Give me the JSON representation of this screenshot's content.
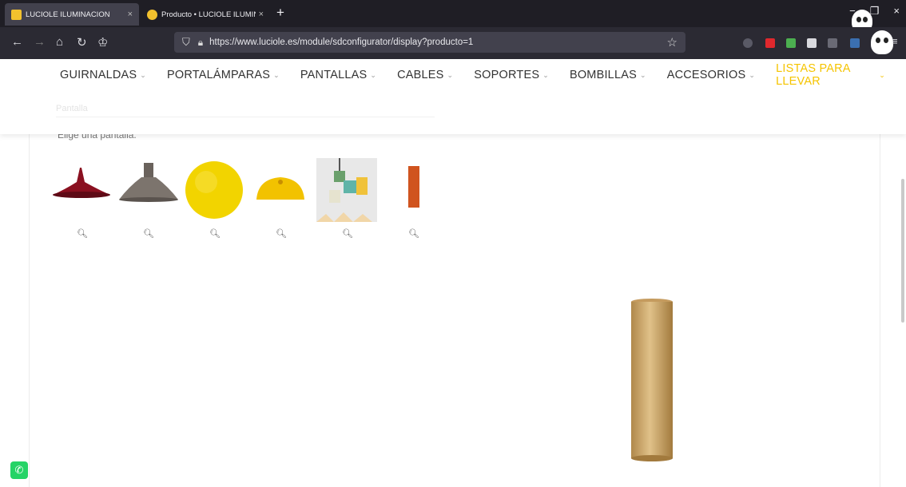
{
  "browser": {
    "tabs": [
      {
        "title": "LUCIOLE ILUMINACION",
        "close": "×"
      },
      {
        "title": "Producto • LUCIOLE ILUMINACI",
        "close": "×"
      }
    ],
    "new_tab": "+",
    "url": "https://www.luciole.es/module/sdconfigurator/display?producto=1",
    "window_controls": {
      "minimize": "−",
      "close": "×"
    }
  },
  "menu": {
    "items": [
      {
        "label": "GUIRNALDAS"
      },
      {
        "label": "PORTALÁMPARAS"
      },
      {
        "label": "PANTALLAS"
      },
      {
        "label": "CABLES"
      },
      {
        "label": "SOPORTES"
      },
      {
        "label": "BOMBILLAS"
      },
      {
        "label": "ACCESORIOS"
      },
      {
        "label": "LISTAS PARA LLEVAR"
      }
    ],
    "chevron": "⌄",
    "highlight_color": "#f5c400"
  },
  "configurator": {
    "section_label": "Pantalla",
    "prompt": "Elige una pantalla."
  },
  "thumbnails": [
    {
      "icon": "zoom-icon"
    },
    {
      "icon": "zoom-icon"
    },
    {
      "icon": "zoom-icon"
    },
    {
      "icon": "zoom-icon"
    },
    {
      "icon": "zoom-icon"
    },
    {
      "icon": "zoom-icon"
    }
  ],
  "colors": {
    "tabstrip": "#1f1e25",
    "navbar": "#2b2a33",
    "urlbar": "#42414d",
    "accent_yellow": "#f5c400",
    "whatsapp": "#25d366"
  }
}
